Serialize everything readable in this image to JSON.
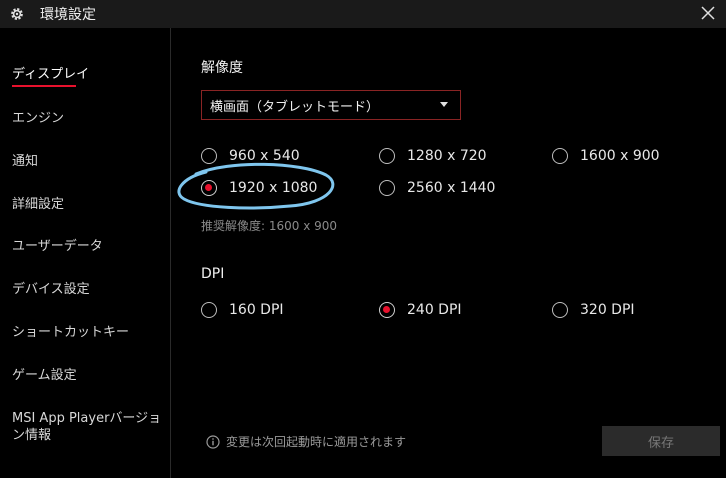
{
  "window": {
    "title": "環境設定",
    "title_icon": "gear-icon",
    "close_icon": "close-icon"
  },
  "sidebar": {
    "items": [
      {
        "label": "ディスプレイ",
        "active": true
      },
      {
        "label": "エンジン"
      },
      {
        "label": "通知"
      },
      {
        "label": "詳細設定"
      },
      {
        "label": "ユーザーデータ"
      },
      {
        "label": "デバイス設定"
      },
      {
        "label": "ショートカットキー"
      },
      {
        "label": "ゲーム設定"
      },
      {
        "label": "MSI App Playerバージョ",
        "label_line2": "ン情報"
      }
    ]
  },
  "resolution": {
    "title": "解像度",
    "orientation_select": "横画面（タブレットモード）",
    "options": [
      {
        "label": "960 x 540",
        "selected": false
      },
      {
        "label": "1280 x 720",
        "selected": false
      },
      {
        "label": "1600 x 900",
        "selected": false
      },
      {
        "label": "1920 x 1080",
        "selected": true
      },
      {
        "label": "2560 x 1440",
        "selected": false
      }
    ],
    "recommended": "推奨解像度: 1600 x 900"
  },
  "dpi": {
    "title": "DPI",
    "options": [
      {
        "label": "160 DPI",
        "selected": false
      },
      {
        "label": "240 DPI",
        "selected": true
      },
      {
        "label": "320 DPI",
        "selected": false
      }
    ]
  },
  "footer": {
    "notice": "変更は次回起動時に適用されます",
    "notice_icon": "info-icon",
    "save_label": "保存"
  },
  "colors": {
    "accent": "#e8112d",
    "annotation": "#7fc6ee"
  }
}
